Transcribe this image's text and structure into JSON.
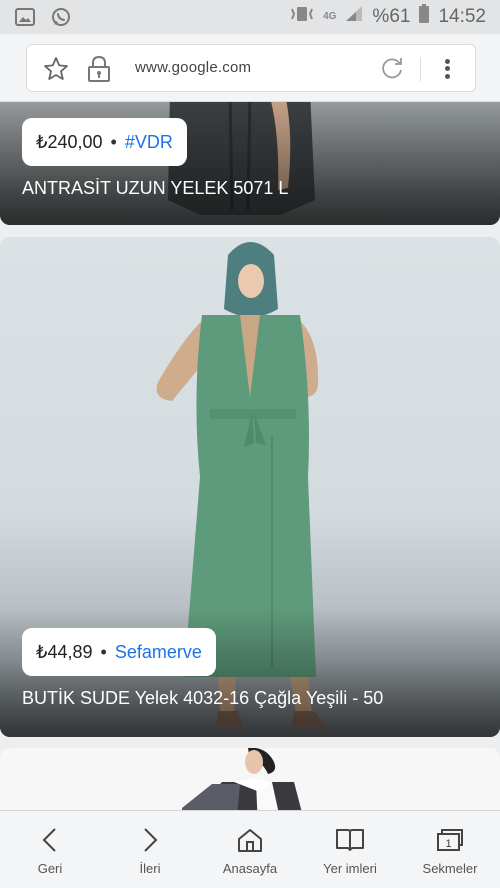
{
  "status_bar": {
    "network": "4G",
    "battery": "%61",
    "time": "14:52"
  },
  "browser": {
    "url": "www.google.com"
  },
  "cards": [
    {
      "price": "₺240,00",
      "source": "#VDR",
      "title": "ANTRASİT UZUN YELEK 5071 L"
    },
    {
      "price": "₺44,89",
      "source": "Sefamerve",
      "title": "BUTİK SUDE Yelek 4032-16 Çağla Yeşili - 50"
    }
  ],
  "bottom_nav": [
    {
      "label": "Geri",
      "icon": "back-icon"
    },
    {
      "label": "İleri",
      "icon": "forward-icon"
    },
    {
      "label": "Anasayfa",
      "icon": "home-icon"
    },
    {
      "label": "Yer imleri",
      "icon": "bookmarks-icon"
    },
    {
      "label": "Sekmeler",
      "icon": "tabs-icon"
    }
  ],
  "bottom_nav_tab_count": "1",
  "colors": {
    "link": "#1a73e8",
    "vest": "#5e9b7c"
  }
}
